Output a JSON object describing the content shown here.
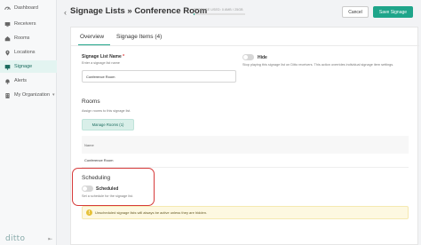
{
  "sidebar": {
    "items": [
      {
        "label": "Dashboard",
        "icon": "dashboard-icon"
      },
      {
        "label": "Receivers",
        "icon": "monitor-icon"
      },
      {
        "label": "Rooms",
        "icon": "home-icon"
      },
      {
        "label": "Locations",
        "icon": "pin-icon"
      },
      {
        "label": "Signage",
        "icon": "signage-icon",
        "active": true
      },
      {
        "label": "Alerts",
        "icon": "bell-icon"
      },
      {
        "label": "My Organization",
        "icon": "org-icon",
        "chevron": "▾"
      }
    ],
    "logo": "ditto",
    "collapse_glyph": "⇤"
  },
  "header": {
    "back_glyph": "‹",
    "title": "Signage Lists » Conference Room",
    "storage_text": "STORAGE USED: 0.6MB / 25GB",
    "storage_fraction": 0.02,
    "cancel_label": "Cancel",
    "save_label": "Save Signage"
  },
  "tabs": {
    "overview": "Overview",
    "items": "Signage Items (4)"
  },
  "form": {
    "name_label": "Signage List Name",
    "name_required": "*",
    "name_hint": "Enter a signage list name",
    "name_value": "Conference Room",
    "hide_label": "Hide",
    "hide_hint": "Stop playing this signage list on Ditto receivers. This action overrides individual signage item settings."
  },
  "rooms": {
    "title": "Rooms",
    "hint": "Assign rooms to this signage list.",
    "manage_label": "Manage Rooms (1)",
    "table_header": "Name",
    "rows": [
      "Conference Room"
    ]
  },
  "scheduling": {
    "title": "Scheduling",
    "toggle_label": "Scheduled",
    "hint": "Set a schedule for the signage list.",
    "warning": "Unscheduled signage lists will always be active unless they are hidden."
  },
  "colors": {
    "accent": "#1fa58a",
    "highlight": "#d63a3a",
    "warning_bg": "#fdf8e1"
  }
}
